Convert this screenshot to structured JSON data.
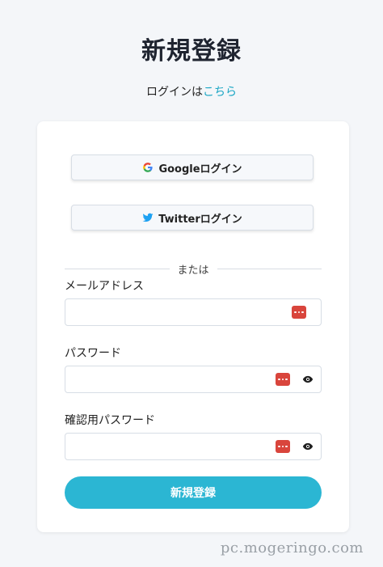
{
  "page": {
    "title": "新規登録",
    "login_prompt": "ログインは",
    "login_link": "こちら"
  },
  "social": {
    "google_label": "Googleログイン",
    "twitter_label": "Twitterログイン"
  },
  "divider_text": "または",
  "form": {
    "email_label": "メールアドレス",
    "email_value": "",
    "password_label": "パスワード",
    "password_value": "",
    "confirm_label": "確認用パスワード",
    "confirm_value": "",
    "submit_label": "新規登録"
  },
  "watermark": "pc.mogeringo.com",
  "colors": {
    "accent": "#2bb6d3",
    "link": "#1aa6c4",
    "password_manager": "#d9453c",
    "twitter": "#1da1f2"
  },
  "icons": [
    "google-icon",
    "twitter-icon",
    "password-manager-icon",
    "eye-icon"
  ]
}
